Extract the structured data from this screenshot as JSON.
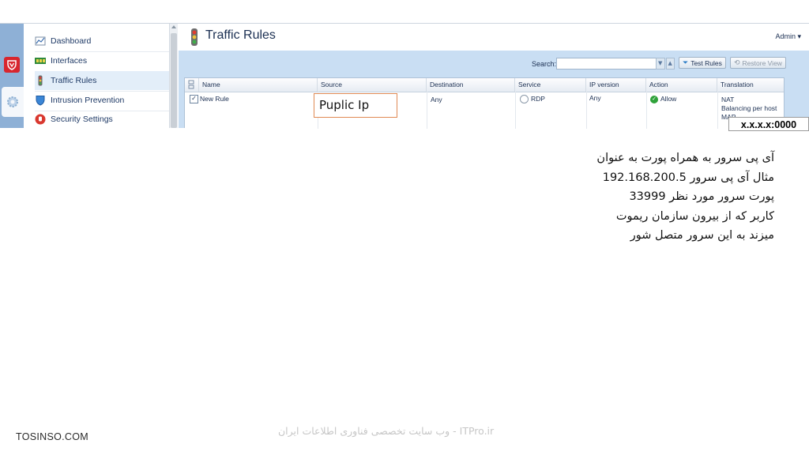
{
  "sidebar": {
    "items": [
      {
        "label": "Dashboard",
        "icon": "chart-icon",
        "active": false
      },
      {
        "label": "Interfaces",
        "icon": "network-card-icon",
        "active": false
      },
      {
        "label": "Traffic Rules",
        "icon": "traffic-light-icon",
        "active": true
      },
      {
        "label": "Intrusion Prevention",
        "icon": "shield-icon",
        "active": false
      },
      {
        "label": "Security Settings",
        "icon": "security-hand-icon",
        "active": false
      }
    ]
  },
  "header": {
    "title": "Traffic Rules",
    "admin_label": "Admin ▾"
  },
  "toolbar": {
    "search_label": "Search:",
    "search_value": "",
    "test_rules_label": "Test Rules",
    "restore_view_label": "Restore View"
  },
  "grid": {
    "columns": [
      "Name",
      "Source",
      "Destination",
      "Service",
      "IP version",
      "Action",
      "Translation"
    ],
    "rows": [
      {
        "checked": true,
        "name": "New Rule",
        "source": "",
        "destination": "Any",
        "service": "RDP",
        "ip_version": "Any",
        "action": "Allow",
        "translation": [
          "NAT",
          "Balancing per host",
          "MAP"
        ]
      }
    ]
  },
  "annotations": {
    "source_box": "Puplic Ip",
    "ip_label": "x.x.x.x:0000",
    "note_lines": [
      "آی پی سرور به همراه پورت به عنوان",
      "مثال آی پی سرور 192.168.200.5",
      "پورت سرور مورد نظر 33999",
      "کاربر که از بیرون سازمان ریموت",
      "میزند به این سرور متصل شور"
    ]
  },
  "footer": {
    "left": "TOSINSO.COM",
    "center": "ITPro.ir - وب سایت تخصصی فناوری اطلاعات ایران"
  },
  "colors": {
    "rail": "#8eb0d6",
    "toolbar": "#c9def3",
    "annotation_border": "#e08a55",
    "allow_green": "#2fa23a",
    "brand_red": "#d8262e"
  }
}
